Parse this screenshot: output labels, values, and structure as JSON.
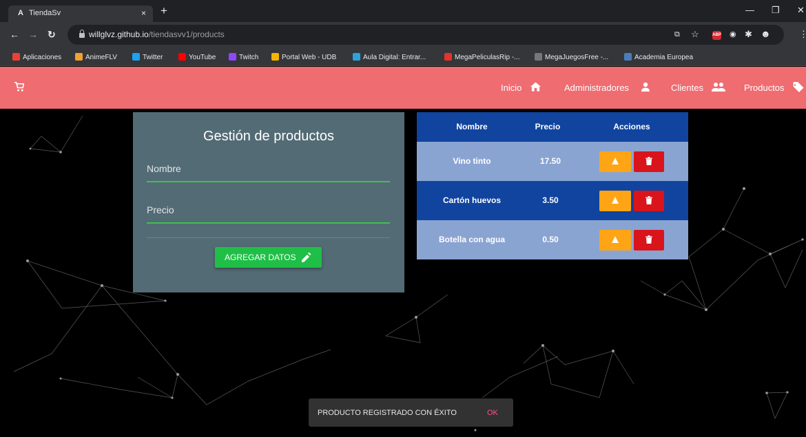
{
  "browser": {
    "tab_title": "TiendaSv",
    "tab_favicon": "A",
    "tab_close": "×",
    "new_tab": "+",
    "url_host": "willglvz.github.io",
    "url_path": "/tiendasvv1/products",
    "bookmarks": [
      {
        "label": "Aplicaciones",
        "icon": "apps-grid-icon",
        "color": "#e94235"
      },
      {
        "label": "AnimeFLV",
        "icon": "animeflv-icon",
        "color": "#f1a033"
      },
      {
        "label": "Twitter",
        "icon": "twitter-icon",
        "color": "#1da1f2"
      },
      {
        "label": "YouTube",
        "icon": "youtube-icon",
        "color": "#ff0000"
      },
      {
        "label": "Twitch",
        "icon": "twitch-icon",
        "color": "#9146ff"
      },
      {
        "label": "Portal Web - UDB",
        "icon": "udb-icon",
        "color": "#f5b400"
      },
      {
        "label": "Aula Digital: Entrar...",
        "icon": "aula-icon",
        "color": "#2aa4d8"
      },
      {
        "label": "MegaPeliculasRip -...",
        "icon": "megapeliculas-icon",
        "color": "#e5322d"
      },
      {
        "label": "MegaJuegosFree -...",
        "icon": "megajuegos-icon",
        "color": "#777777"
      },
      {
        "label": "Academia Europea",
        "icon": "academia-icon",
        "color": "#4a7ebb"
      }
    ]
  },
  "nav": {
    "links": [
      {
        "label": "Inicio",
        "icon": "home-icon"
      },
      {
        "label": "Administradores",
        "icon": "person-icon"
      },
      {
        "label": "Clientes",
        "icon": "people-icon"
      },
      {
        "label": "Productos",
        "icon": "tag-icon"
      }
    ]
  },
  "form": {
    "title": "Gestión de productos",
    "fields": [
      {
        "label": "Nombre",
        "value": ""
      },
      {
        "label": "Precio",
        "value": ""
      }
    ],
    "submit_label": "AGREGAR DATOS"
  },
  "table": {
    "headers": [
      "Nombre",
      "Precio",
      "Acciones"
    ],
    "rows": [
      {
        "nombre": "Vino tinto",
        "precio": "17.50"
      },
      {
        "nombre": "Cartón huevos",
        "precio": "3.50"
      },
      {
        "nombre": "Botella con agua",
        "precio": "0.50"
      }
    ]
  },
  "snackbar": {
    "message": "PRODUCTO REGISTRADO CON ÉXITO",
    "action": "OK"
  },
  "colors": {
    "nav_bg": "#ef6c71",
    "card_bg": "#536b75",
    "accent_green": "#1fbf47",
    "table_dark": "#10449f",
    "table_light": "#8aa4d2",
    "edit_orange": "#ffa515",
    "delete_red": "#d9151b",
    "snack_action": "#ff4f8b"
  }
}
